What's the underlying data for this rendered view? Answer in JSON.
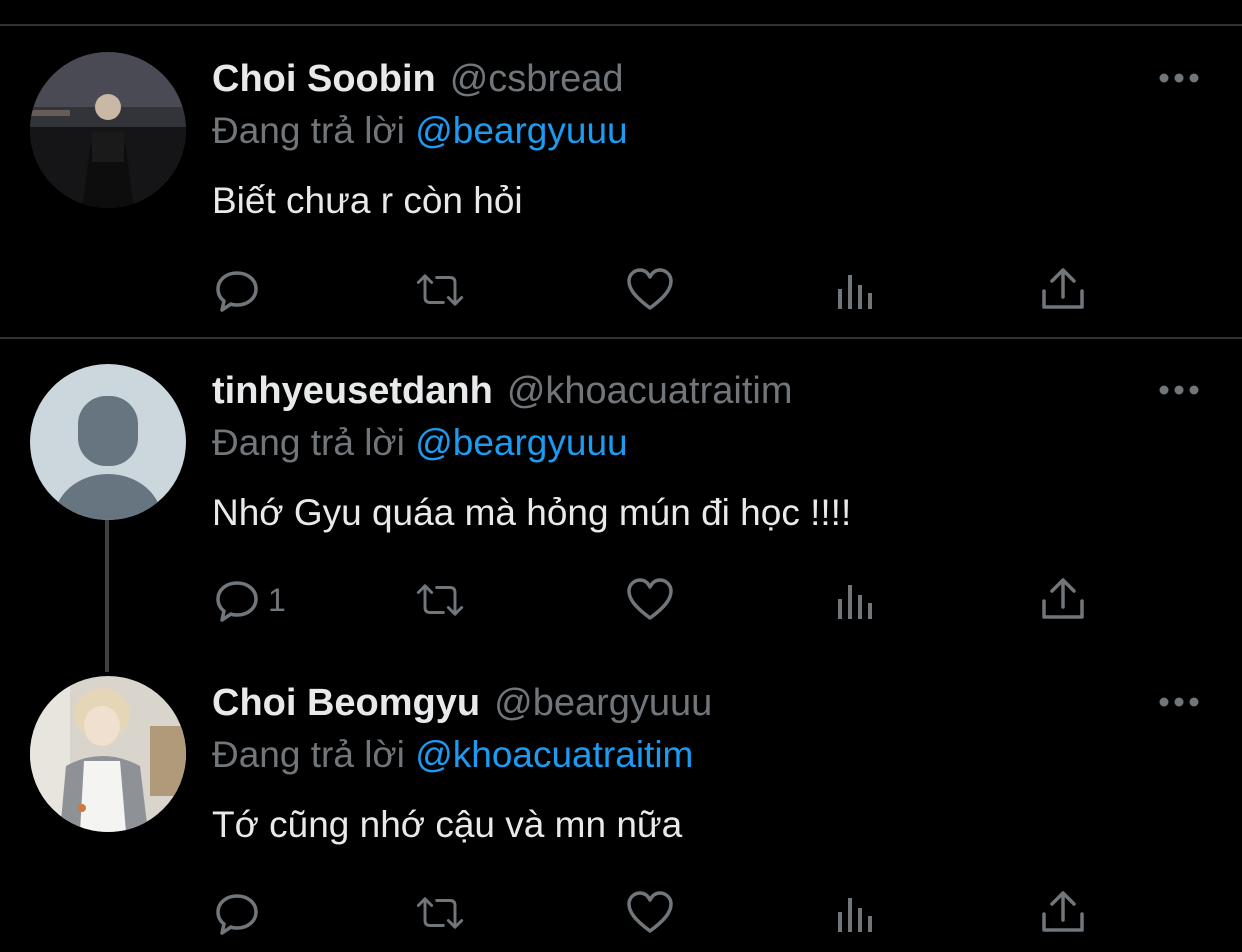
{
  "tweets": [
    {
      "name": "Choi Soobin",
      "handle": "@csbread",
      "replying_prefix": "Đang trả lời",
      "replying_to": "@beargyuuu",
      "text": "Biết chưa r còn hỏi",
      "reply_count": ""
    },
    {
      "name": "tinhyeusetdanh",
      "handle": "@khoacuatraitim",
      "replying_prefix": "Đang trả lời",
      "replying_to": "@beargyuuu",
      "text": "Nhớ Gyu quáa mà hỏng mún đi học !!!!",
      "reply_count": "1"
    },
    {
      "name": "Choi Beomgyu",
      "handle": "@beargyuuu",
      "replying_prefix": "Đang trả lời",
      "replying_to": "@khoacuatraitim",
      "text": "Tớ cũng nhớ cậu và mn nữa",
      "reply_count": ""
    }
  ],
  "icons": {
    "reply": "reply-icon",
    "retweet": "retweet-icon",
    "like": "heart-icon",
    "analytics": "analytics-icon",
    "share": "share-icon",
    "more": "more-icon"
  },
  "colors": {
    "background": "#000000",
    "text": "#e7e9ea",
    "secondary": "#71767b",
    "mention": "#1d9bf0",
    "divider": "#2f3336"
  }
}
